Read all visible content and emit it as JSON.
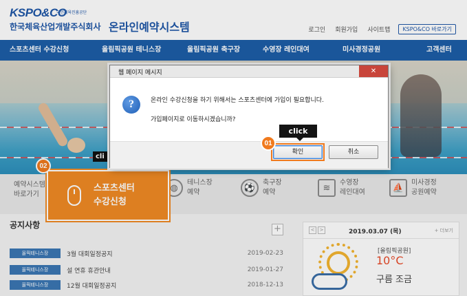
{
  "header": {
    "logo_text": "KSPO&CO",
    "logo_sub": "국민체육진흥공단",
    "company": "한국체육산업개발주식회사",
    "system_title": "온라인예약시스템",
    "util_links": [
      "로그인",
      "회원가입",
      "사이트맵"
    ],
    "util_button": "KSPO&CO 바로가기"
  },
  "nav": {
    "items": [
      "스포츠센터 수강신청",
      "올림픽공원 테니스장",
      "올림픽공원 축구장",
      "수영장 레인대여",
      "미사경정공원",
      "고객센터"
    ]
  },
  "hero": {
    "click_tag": "cli"
  },
  "quick_menu": {
    "first_label": "예약시스템\n바로가기",
    "highlight_label": "스포츠센터\n수강신청",
    "items": [
      {
        "label": "테니스장\n예약",
        "icon": "tennis-icon"
      },
      {
        "label": "축구장\n예약",
        "icon": "soccer-icon"
      },
      {
        "label": "수영장\n레인대여",
        "icon": "swimming-icon"
      },
      {
        "label": "미사경정\n공원예약",
        "icon": "boat-icon"
      }
    ]
  },
  "notice": {
    "title": "공지사항",
    "plus": "+",
    "rows": [
      {
        "tag": "올픽테니스장",
        "text": "3월 대회일정공지",
        "date": "2019-02-23"
      },
      {
        "tag": "올픽테니스장",
        "text": "설 연휴 휴관안내",
        "date": "2019-01-27"
      },
      {
        "tag": "올픽테니스장",
        "text": "12월 대회일정공지",
        "date": "2018-12-13"
      }
    ]
  },
  "weather": {
    "prev": "<",
    "next": ">",
    "date": "2019.03.07 (목)",
    "more": "+ 더보기",
    "place": "[올림픽공원]",
    "temp": "10°C",
    "desc": "구름 조금"
  },
  "dialog": {
    "title": "웹 페이지 메시지",
    "close": "✕",
    "message_line1": "온라인 수강신청을 하기 위해서는 스포츠센터에 가입이 필요합니다.",
    "message_line2": "가입페이지로 이동하시겠습니까?",
    "ok_label": "확인",
    "cancel_label": "취소"
  },
  "annotations": {
    "click_tip": "click",
    "badge_01": "01",
    "badge_02": "02"
  },
  "colors": {
    "brand_blue": "#1d5ea8",
    "highlight_orange": "#f08a24",
    "temp_red": "#e94b2a"
  }
}
